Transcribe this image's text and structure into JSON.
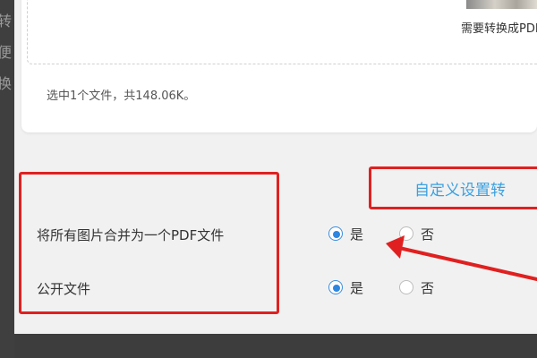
{
  "left_margin": {
    "glyphs": [
      "转",
      "便",
      "换"
    ]
  },
  "upload": {
    "file_name": "需要转换成PDF",
    "summary": "选中1个文件，共148.06K。"
  },
  "settings": {
    "custom_link": "自定义设置转",
    "merge_label": "将所有图片合并为一个PDF文件",
    "public_label": "公开文件",
    "yes_label": "是",
    "no_label": "否",
    "merge_value": "是",
    "public_value": "是"
  },
  "annotations": {
    "highlight_color": "#e02020",
    "accent": "#2f86dd",
    "link_color": "#3ba0e0"
  }
}
